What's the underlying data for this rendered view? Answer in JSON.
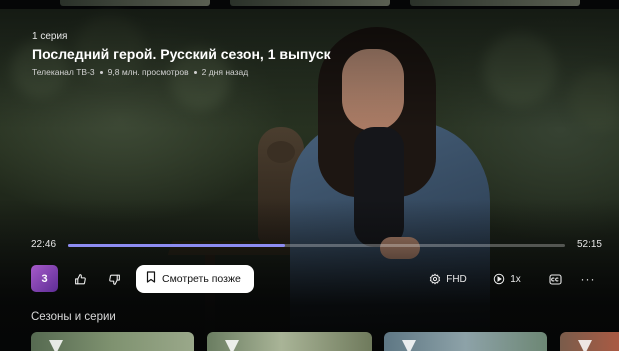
{
  "episode": {
    "number_label": "1 серия",
    "title": "Последний герой. Русский сезон, 1 выпуск",
    "channel": "Телеканал ТВ-3",
    "views": "9,8 млн. просмотров",
    "age": "2 дня назад"
  },
  "player": {
    "current_time": "22:46",
    "duration": "52:15",
    "progress": 0.4357
  },
  "controls": {
    "logo_text": "3",
    "like_icon": "thumbs-up-icon",
    "dislike_icon": "thumbs-down-icon",
    "watch_later_label": "Смотреть позже",
    "watch_later_icon": "bookmark-icon",
    "quality_label": "FHD",
    "quality_icon": "gear-icon",
    "speed_label": "1x",
    "speed_icon": "play-circle-icon",
    "subtitles_icon": "subtitles-icon",
    "more_label": "···"
  },
  "seasons": {
    "title": "Сезоны и серии"
  },
  "colors": {
    "accent": "#8d8cf2",
    "logo": "#8a46b8",
    "pill": "#ffffff"
  }
}
